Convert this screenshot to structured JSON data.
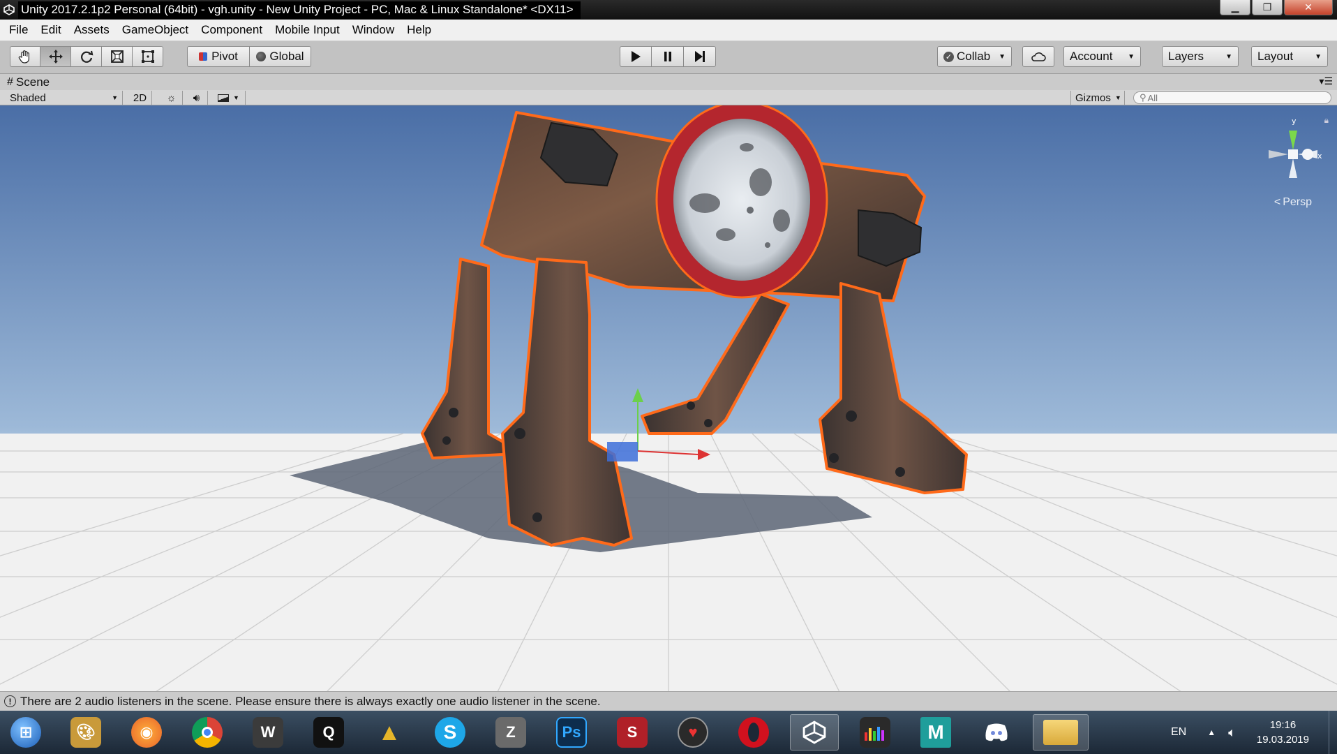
{
  "window": {
    "title": "Unity 2017.2.1p2 Personal (64bit) - vgh.unity - New Unity Project - PC, Mac & Linux Standalone* <DX11>"
  },
  "menu": [
    "File",
    "Edit",
    "Assets",
    "GameObject",
    "Component",
    "Mobile Input",
    "Window",
    "Help"
  ],
  "toolbar": {
    "tools": [
      "hand-icon",
      "move-icon",
      "rotate-icon",
      "scale-icon",
      "rect-tool-icon"
    ],
    "pivot_label": "Pivot",
    "global_label": "Global",
    "play": [
      "play-icon",
      "pause-icon",
      "step-icon"
    ],
    "collab_label": "Collab",
    "account_label": "Account",
    "layers_label": "Layers",
    "layout_label": "Layout"
  },
  "scene": {
    "tab_label": "Scene",
    "shading_mode": "Shaded",
    "mode_2d": "2D",
    "gizmos_label": "Gizmos",
    "search_placeholder": "All",
    "persp_label": "Persp",
    "axis_x": "x",
    "axis_y": "y"
  },
  "status": {
    "message": "There are 2 audio listeners in the scene. Please ensure there is always exactly one audio listener in the scene."
  },
  "taskbar": {
    "apps": [
      {
        "name": "start-button",
        "color": "#2f7fd9"
      },
      {
        "name": "paint-icon",
        "color": "#c99a3a"
      },
      {
        "name": "firefox-icon",
        "color": "#e8622a"
      },
      {
        "name": "chrome-icon",
        "color": "#3a9a45"
      },
      {
        "name": "world-of-tanks-icon",
        "color": "#3b3b3b"
      },
      {
        "name": "quixel-icon",
        "color": "#111111"
      },
      {
        "name": "archicad-icon",
        "color": "#e5b52a"
      },
      {
        "name": "skype-icon",
        "color": "#1ea7e8"
      },
      {
        "name": "zbrush-icon",
        "color": "#6a6a6a"
      },
      {
        "name": "photoshop-icon",
        "color": "#0d2d4d"
      },
      {
        "name": "substance-painter-icon",
        "color": "#b02028"
      },
      {
        "name": "heart-app-icon",
        "color": "#2a2a2a"
      },
      {
        "name": "opera-icon",
        "color": "#d1111e"
      },
      {
        "name": "unity-icon",
        "color": "#333333"
      },
      {
        "name": "equalizer-icon",
        "color": "#2a2a2a"
      },
      {
        "name": "maya-icon",
        "color": "#1f9e9b"
      },
      {
        "name": "discord-icon",
        "color": "#7289da"
      },
      {
        "name": "explorer-icon",
        "color": "#e0b23b"
      }
    ],
    "language": "EN",
    "time": "19:16",
    "date": "19.03.2019"
  }
}
